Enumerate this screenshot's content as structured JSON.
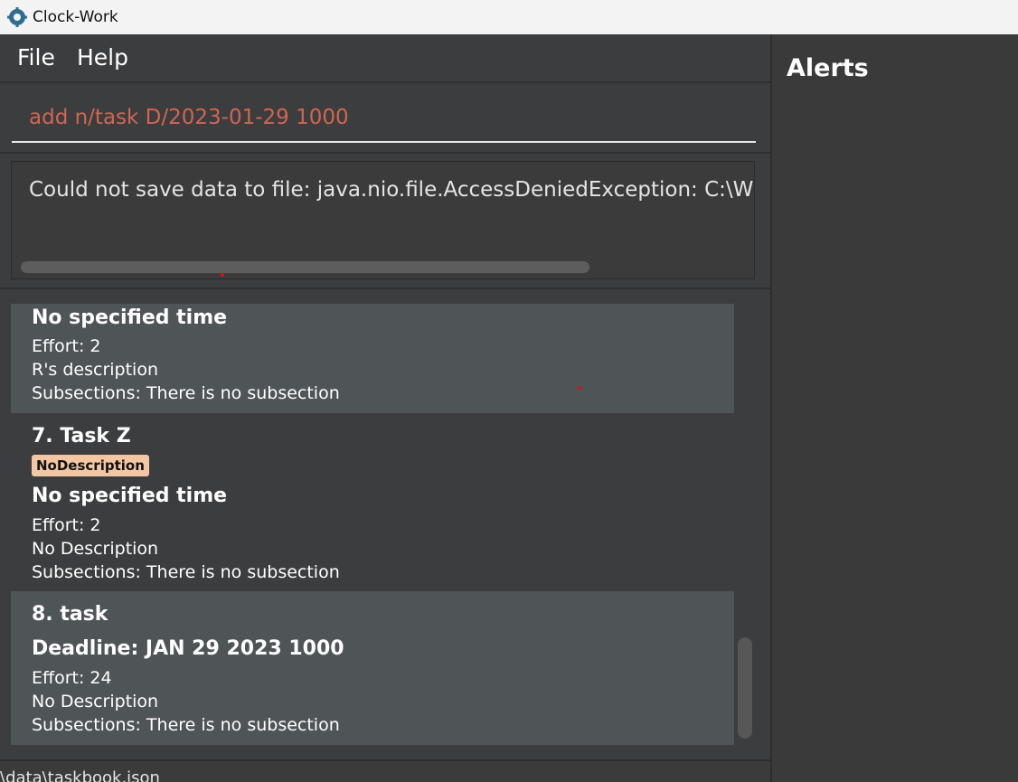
{
  "window": {
    "title": "Clock-Work",
    "icon": "gear-icon"
  },
  "menu": {
    "file": "File",
    "help": "Help"
  },
  "command_box": {
    "value": "add n/task D/2023-01-29 1000"
  },
  "result_display": {
    "text": "Could not save data to file: java.nio.file.AccessDeniedException: C:\\WINDC"
  },
  "tasks": [
    {
      "time": "No specified time",
      "effort": "Effort: 2",
      "description": "R's description",
      "subsections": "Subsections: There is no subsection"
    },
    {
      "title": "7.  Task Z",
      "tag": "NoDescription",
      "time": "No specified time",
      "effort": "Effort: 2",
      "description": "No Description",
      "subsections": "Subsections: There is no subsection"
    },
    {
      "title": "8.  task",
      "time": "Deadline: JAN 29 2023 1000",
      "effort": "Effort: 24",
      "description": "No Description",
      "subsections": "Subsections: There is no subsection"
    }
  ],
  "status_bar": {
    "path": "\\data\\taskbook.json"
  },
  "alerts": {
    "title": "Alerts"
  },
  "colors": {
    "background": "#3c3d3e",
    "card_light": "#4f5457",
    "command_text": "#d06651",
    "tag_bg": "#f3c6a4"
  }
}
